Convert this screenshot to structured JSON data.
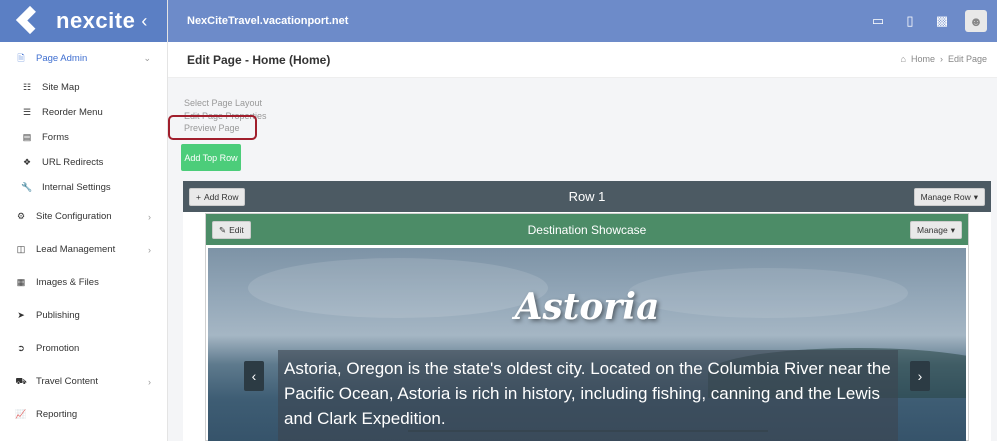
{
  "brand": {
    "name": "nexcite",
    "collapse_icon": "chevron-left-icon"
  },
  "topbar": {
    "title": "NexCiteTravel.vacationport.net"
  },
  "sidebar": {
    "page_admin": {
      "label": "Page Admin",
      "icon": "file-icon"
    },
    "sub_items": [
      {
        "label": "Site Map",
        "icon": "sitemap-icon"
      },
      {
        "label": "Reorder Menu",
        "icon": "list-icon"
      },
      {
        "label": "Forms",
        "icon": "form-icon"
      },
      {
        "label": "URL Redirects",
        "icon": "redirect-icon"
      },
      {
        "label": "Internal Settings",
        "icon": "wrench-icon"
      }
    ],
    "items": [
      {
        "label": "Site Configuration",
        "icon": "gear-icon",
        "has_children": true
      },
      {
        "label": "Lead Management",
        "icon": "clipboard-icon",
        "has_children": true
      },
      {
        "label": "Images & Files",
        "icon": "image-icon",
        "has_children": false
      },
      {
        "label": "Publishing",
        "icon": "rocket-icon",
        "has_children": false
      },
      {
        "label": "Promotion",
        "icon": "arrow-circle-icon",
        "has_children": false
      },
      {
        "label": "Travel Content",
        "icon": "car-icon",
        "has_children": true
      },
      {
        "label": "Reporting",
        "icon": "chart-icon",
        "has_children": false
      }
    ]
  },
  "header": {
    "title": "Edit Page - Home (Home)",
    "breadcrumb": {
      "home": "Home",
      "current": "Edit Page"
    }
  },
  "actions": {
    "select_layout": "Select Page Layout",
    "edit_properties": "Edit Page Properties",
    "preview": "Preview Page",
    "add_top_row": "Add Top Row"
  },
  "row": {
    "title": "Row 1",
    "add_row": "Add Row",
    "manage_row": "Manage Row"
  },
  "module": {
    "title": "Destination Showcase",
    "edit": "Edit",
    "manage": "Manage"
  },
  "slide": {
    "title": "Astoria",
    "caption": "Astoria, Oregon is the state's oldest city. Located on the Columbia River near the Pacific Ocean, Astoria is rich in history, including fishing, canning and the Lewis and Clark Expedition."
  },
  "colors": {
    "brand": "#5b7fc4",
    "topbar": "#6d8bc9",
    "row_bar": "#4c5a63",
    "module_bar": "#4c8c67",
    "add_top_row": "#4ccd7a",
    "highlight": "#a01e2c"
  }
}
